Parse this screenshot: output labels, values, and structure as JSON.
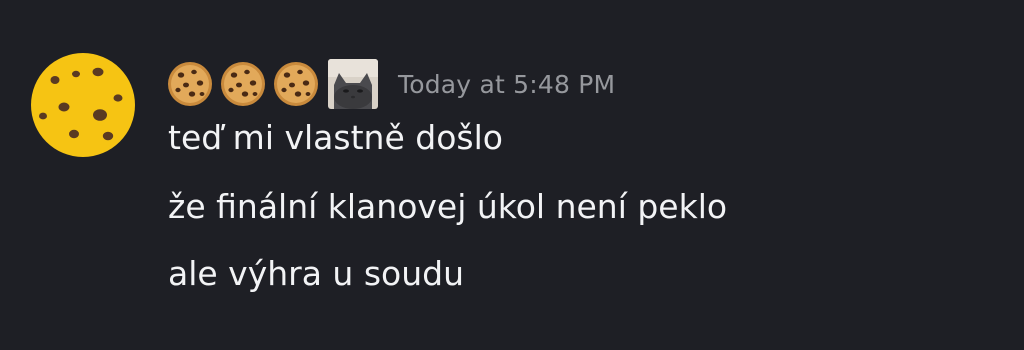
{
  "message": {
    "avatar_icon": "cookie-icon",
    "username_emojis": [
      "cookie-icon",
      "cookie-icon",
      "cookie-icon",
      "cat-emoji-icon"
    ],
    "timestamp": "Today at 5:48 PM",
    "lines": [
      "teď mi vlastně došlo",
      "že finální klanovej úkol není peklo",
      "ale výhra u soudu"
    ]
  },
  "colors": {
    "background": "#1e1f25",
    "text": "#f2f3f5",
    "timestamp": "#96989d",
    "avatar_cookie": "#f6c413"
  }
}
